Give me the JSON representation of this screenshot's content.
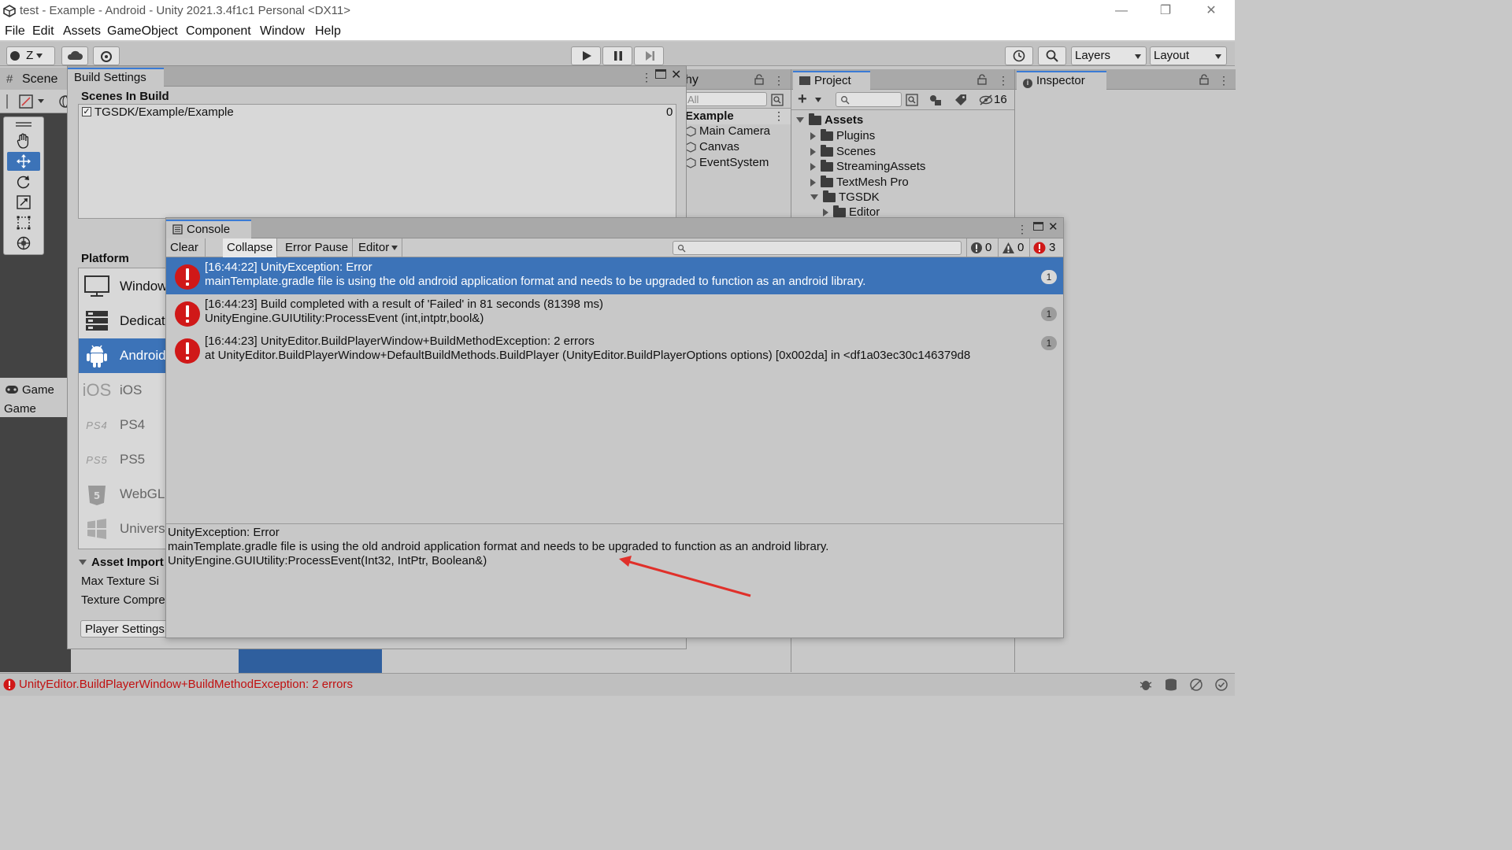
{
  "window": {
    "title": "test - Example - Android - Unity 2021.3.4f1c1 Personal <DX11>",
    "controls": {
      "minimize": "—",
      "restore": "❐",
      "close": "✕"
    }
  },
  "menu": [
    "File",
    "Edit",
    "Assets",
    "GameObject",
    "Component",
    "Window",
    "Help"
  ],
  "toolbar": {
    "account_label": "Z",
    "layers_label": "Layers",
    "layout_label": "Layout"
  },
  "scene": {
    "tab_label": "Scene"
  },
  "game": {
    "tab_label": "Game",
    "sub_label": "Game"
  },
  "build_settings": {
    "tab_label": "Build Settings",
    "scenes_heading": "Scenes In Build",
    "scenes": [
      {
        "path": "TGSDK/Example/Example",
        "index": "0",
        "checked": true
      }
    ],
    "platform_heading": "Platform",
    "platforms": [
      {
        "label": "Window",
        "icon": "monitor-icon"
      },
      {
        "label": "Dedicat",
        "icon": "server-icon"
      },
      {
        "label": "Android",
        "icon": "android-icon"
      },
      {
        "label": "iOS",
        "icon": "ios-icon",
        "glyph": "iOS"
      },
      {
        "label": "PS4",
        "icon": "ps4-icon",
        "glyph": "PS4"
      },
      {
        "label": "PS5",
        "icon": "ps5-icon",
        "glyph": "PS5"
      },
      {
        "label": "WebGL",
        "icon": "html5-icon"
      },
      {
        "label": "Univers",
        "icon": "windows-icon"
      }
    ],
    "asset_import_heading": "Asset Import",
    "max_texture_label": "Max Texture Si",
    "texture_compression_label": "Texture Compre",
    "player_settings_button": "Player Settings"
  },
  "hierarchy": {
    "tab_label": "hy",
    "search_placeholder": "All",
    "scene_name": "Example",
    "items": [
      "Main Camera",
      "Canvas",
      "EventSystem"
    ]
  },
  "project": {
    "tab_label": "Project",
    "hidden_count": "16",
    "root": "Assets",
    "folders": [
      "Plugins",
      "Scenes",
      "StreamingAssets",
      "TextMesh Pro",
      "TGSDK",
      "Editor"
    ]
  },
  "inspector": {
    "tab_label": "Inspector"
  },
  "console": {
    "tab_label": "Console",
    "toolbar": {
      "clear": "Clear",
      "collapse": "Collapse",
      "error_pause": "Error Pause",
      "editor": "Editor"
    },
    "counts": {
      "info": "0",
      "warning": "0",
      "error": "3"
    },
    "entries": [
      {
        "line1": "[16:44:22] UnityException: Error",
        "line2": "mainTemplate.gradle file is using the old android application format and needs to be upgraded to function as an android library.",
        "count": "1",
        "selected": true
      },
      {
        "line1": "[16:44:23] Build completed with a result of 'Failed' in 81 seconds (81398 ms)",
        "line2": "UnityEngine.GUIUtility:ProcessEvent (int,intptr,bool&)",
        "count": "1",
        "selected": false
      },
      {
        "line1": "[16:44:23] UnityEditor.BuildPlayerWindow+BuildMethodException: 2 errors",
        "line2": " at UnityEditor.BuildPlayerWindow+DefaultBuildMethods.BuildPlayer (UnityEditor.BuildPlayerOptions options) [0x002da] in <df1a03ec30c146379d8",
        "count": "1",
        "selected": false
      }
    ],
    "detail": [
      "UnityException: Error",
      "mainTemplate.gradle file is using the old android application format and needs to be upgraded to function as an android library.",
      "UnityEngine.GUIUtility:ProcessEvent(Int32, IntPtr, Boolean&)"
    ]
  },
  "status": {
    "message": "UnityEditor.BuildPlayerWindow+BuildMethodException: 2 errors"
  },
  "colors": {
    "selection": "#3c73b8",
    "error": "#d01818",
    "accent": "#3a7bd5",
    "annotation_arrow": "#e0302a"
  }
}
